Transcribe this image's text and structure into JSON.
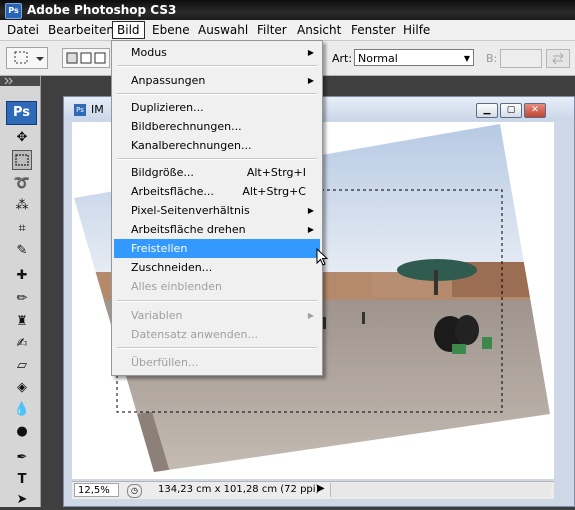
{
  "window": {
    "title": "Adobe Photoshop CS3",
    "app_badge": "Ps"
  },
  "menubar": [
    {
      "label": "Datei"
    },
    {
      "label": "Bearbeiten"
    },
    {
      "label": "Bild"
    },
    {
      "label": "Ebene"
    },
    {
      "label": "Auswahl"
    },
    {
      "label": "Filter"
    },
    {
      "label": "Ansicht"
    },
    {
      "label": "Fenster"
    },
    {
      "label": "Hilfe"
    }
  ],
  "options": {
    "art_label": "Art:",
    "art_value": "Normal",
    "b_label": "B:"
  },
  "tools": {
    "ps_logo": "Ps"
  },
  "document": {
    "title": "IM",
    "zoom": "12,5%",
    "size_info": "134,23 cm x 101,28 cm (72 ppi)"
  },
  "bild_menu": {
    "items": [
      {
        "label": "Modus",
        "submenu": true
      },
      {
        "label": "Anpassungen",
        "submenu": true
      },
      {
        "label": "Duplizieren..."
      },
      {
        "label": "Bildberechnungen..."
      },
      {
        "label": "Kanalberechnungen..."
      },
      {
        "label": "Bildgröße...",
        "shortcut": "Alt+Strg+I"
      },
      {
        "label": "Arbeitsfläche...",
        "shortcut": "Alt+Strg+C"
      },
      {
        "label": "Pixel-Seitenverhältnis",
        "submenu": true
      },
      {
        "label": "Arbeitsfläche drehen",
        "submenu": true
      },
      {
        "label": "Freistellen",
        "highlighted": true
      },
      {
        "label": "Zuschneiden..."
      },
      {
        "label": "Alles einblenden",
        "disabled": true
      },
      {
        "label": "Variablen",
        "submenu": true,
        "disabled": true
      },
      {
        "label": "Datensatz anwenden...",
        "disabled": true
      },
      {
        "label": "Überfüllen...",
        "disabled": true
      }
    ]
  },
  "colors": {
    "highlight": "#3399ff",
    "titlebar": "#1a1a1a"
  }
}
